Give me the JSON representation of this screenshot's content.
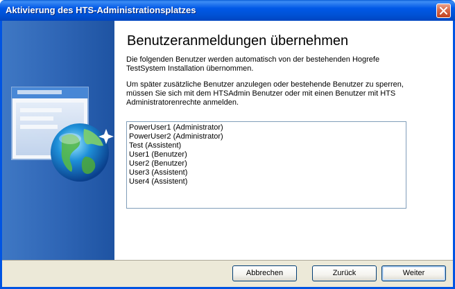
{
  "window": {
    "title": "Aktivierung des HTS-Administrationsplatzes"
  },
  "page": {
    "heading": "Benutzeranmeldungen übernehmen",
    "paragraph1_line1": "Die folgenden Benutzer werden automatisch von der bestehenden Hogrefe",
    "paragraph1_line2": "TestSystem Installation übernommen.",
    "paragraph2_line1": "Um später zusätzliche Benutzer anzulegen oder bestehende Benutzer zu sperren,",
    "paragraph2_line2": "müssen Sie sich mit dem HTSAdmin Benutzer oder mit einen Benutzer mit HTS",
    "paragraph2_line3": "Administratorenrechte anmelden."
  },
  "users": [
    "PowerUser1 (Administrator)",
    "PowerUser2 (Administrator)",
    "Test (Assistent)",
    "User1 (Benutzer)",
    "User2 (Benutzer)",
    "User3 (Assistent)",
    "User4 (Assistent)"
  ],
  "buttons": {
    "cancel": "Abbrechen",
    "back": "Zurück",
    "next": "Weiter"
  },
  "icons": {
    "close": "close-icon",
    "wizard": "window-globe-icon"
  },
  "colors": {
    "titlebar": "#0054e3",
    "sidebar": "#2f66b6",
    "footer": "#ece9d8",
    "close_button": "#d86e4f"
  }
}
